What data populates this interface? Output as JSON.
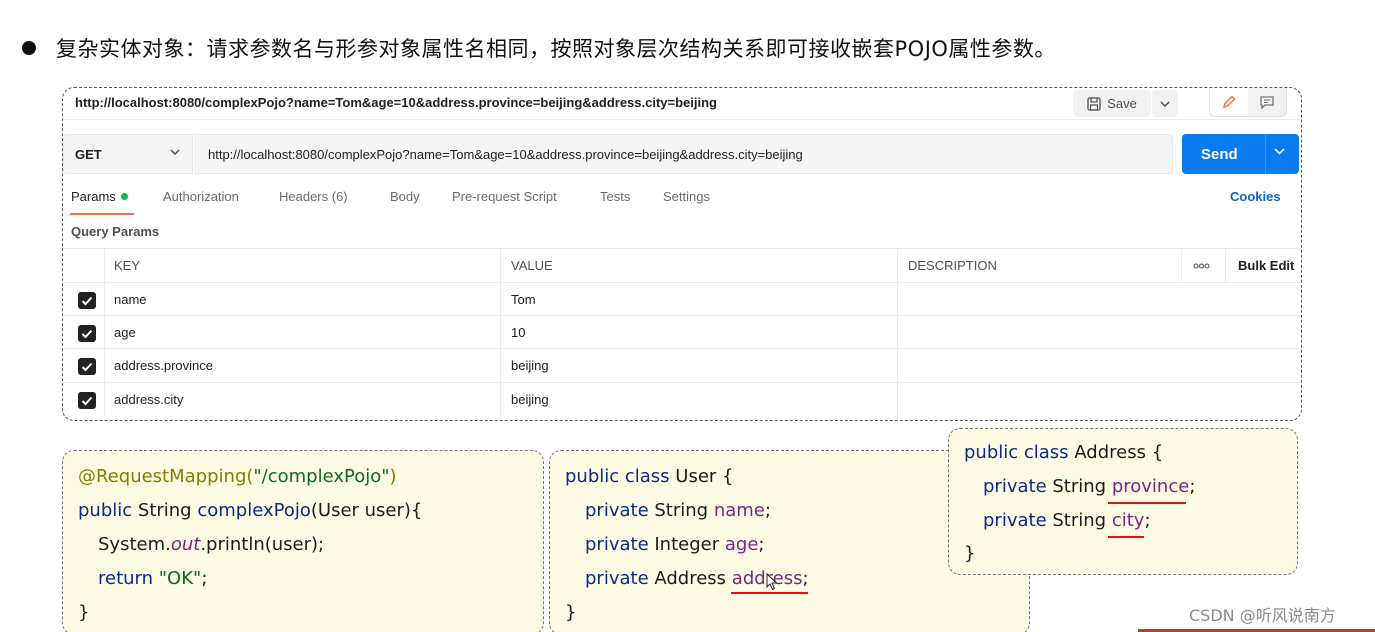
{
  "headline": "复杂实体对象：请求参数名与形参对象属性名相同，按照对象层次结构关系即可接收嵌套POJO属性参数。",
  "postman": {
    "tab_url": "http://localhost:8080/complexPojo?name=Tom&age=10&address.province=beijing&address.city=beijing",
    "save_label": "Save",
    "method": "GET",
    "url": "http://localhost:8080/complexPojo?name=Tom&age=10&address.province=beijing&address.city=beijing",
    "send_label": "Send",
    "tabs": [
      "Params",
      "Authorization",
      "Headers (6)",
      "Body",
      "Pre-request Script",
      "Tests",
      "Settings"
    ],
    "cookies_label": "Cookies",
    "query_params_title": "Query Params",
    "columns": [
      "KEY",
      "VALUE",
      "DESCRIPTION"
    ],
    "bulk_edit_label": "Bulk Edit",
    "rows": [
      {
        "key": "name",
        "value": "Tom",
        "checked": true
      },
      {
        "key": "age",
        "value": "10",
        "checked": true
      },
      {
        "key": "address.province",
        "value": "beijing",
        "checked": true
      },
      {
        "key": "address.city",
        "value": "beijing",
        "checked": true
      }
    ]
  },
  "code": {
    "controller": {
      "annotation": "@RequestMapping(",
      "path": "\"/complexPojo\"",
      "annotation_close": ")",
      "public_kw": "public",
      "sig_type": " String ",
      "method_name": "complexPojo",
      "sig_params": "(User user){",
      "sys": "System.",
      "out": "out",
      "println": ".println(user);",
      "return_kw": "return",
      "ok": "\"OK\"",
      "semicolon": ";",
      "close": "}"
    },
    "user": {
      "decl_kw": "public class",
      "decl_rest": " User {",
      "private_kw": "private",
      "f1_type": " String ",
      "f1": "name",
      "f2_type": " Integer ",
      "f2": "age",
      "f3_type": " Address ",
      "f3": "address",
      "semicolon": ";",
      "close": "}"
    },
    "address": {
      "decl_kw": "public class",
      "decl_rest": " Address {",
      "private_kw": "private",
      "f1_type": " String ",
      "f1": "province",
      "f2_type": " String ",
      "f2": "city",
      "semicolon": ";",
      "close": "}"
    }
  },
  "watermark": "CSDN @听风说南方",
  "colors": {
    "send": "#097bed",
    "accent": "#ff6c37",
    "param_dot": "#0cbb52",
    "code_bg": "#fdfbe3",
    "underline": "#dd1111"
  }
}
